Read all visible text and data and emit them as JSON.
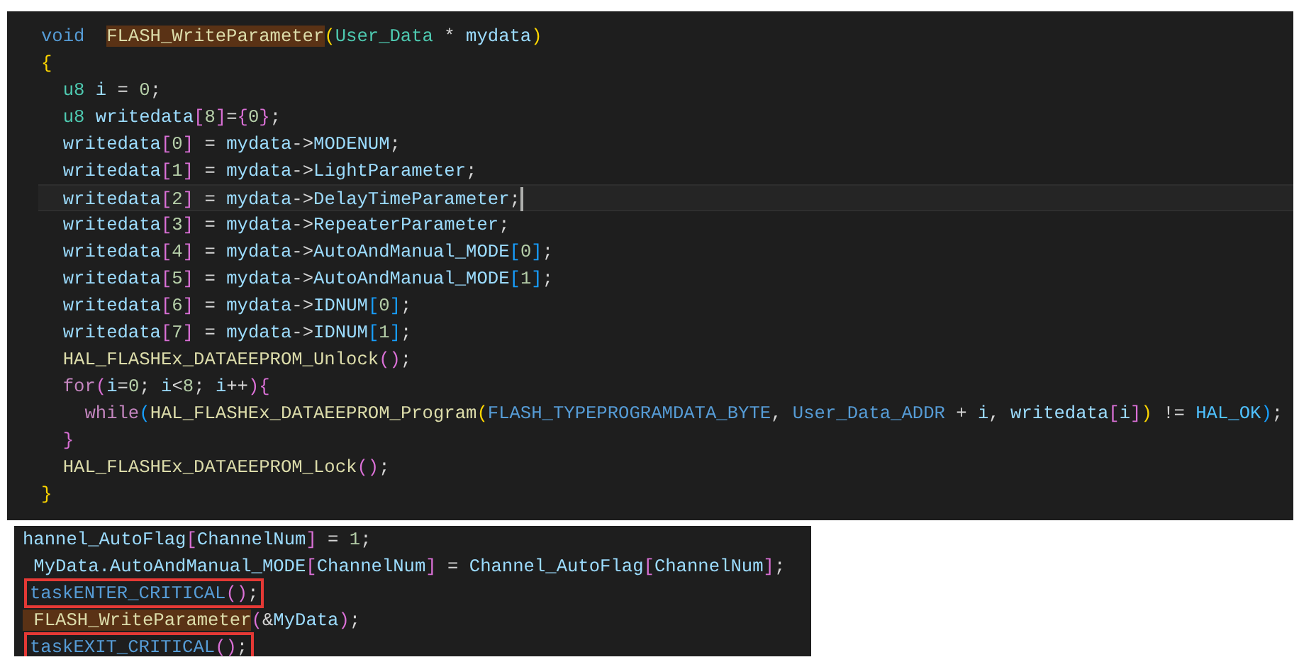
{
  "editors": [
    {
      "lines": [
        {
          "tokens": [
            {
              "kind": "kw",
              "text": "void  "
            },
            {
              "kind": "fnhl",
              "text": "FLASH_WriteParameter"
            },
            {
              "kind": "br1",
              "text": "("
            },
            {
              "kind": "type",
              "text": "User_Data"
            },
            {
              "kind": "plain",
              "text": " * "
            },
            {
              "kind": "var",
              "text": "mydata"
            },
            {
              "kind": "br1",
              "text": ")"
            }
          ]
        },
        {
          "tokens": [
            {
              "kind": "br1",
              "text": "{"
            }
          ]
        },
        {
          "tokens": [
            {
              "kind": "type",
              "text": "  u8"
            },
            {
              "kind": "var",
              "text": " i"
            },
            {
              "kind": "plain",
              "text": " = "
            },
            {
              "kind": "num",
              "text": "0"
            },
            {
              "kind": "plain",
              "text": ";"
            }
          ]
        },
        {
          "tokens": [
            {
              "kind": "type",
              "text": "  u8"
            },
            {
              "kind": "var",
              "text": " writedata"
            },
            {
              "kind": "br2",
              "text": "["
            },
            {
              "kind": "num",
              "text": "8"
            },
            {
              "kind": "br2",
              "text": "]"
            },
            {
              "kind": "plain",
              "text": "="
            },
            {
              "kind": "br2",
              "text": "{"
            },
            {
              "kind": "num",
              "text": "0"
            },
            {
              "kind": "br2",
              "text": "}"
            },
            {
              "kind": "plain",
              "text": ";"
            }
          ]
        },
        {
          "tokens": [
            {
              "kind": "var",
              "text": "  writedata"
            },
            {
              "kind": "br2",
              "text": "["
            },
            {
              "kind": "num",
              "text": "0"
            },
            {
              "kind": "br2",
              "text": "]"
            },
            {
              "kind": "plain",
              "text": " = "
            },
            {
              "kind": "var",
              "text": "mydata"
            },
            {
              "kind": "plain",
              "text": "->"
            },
            {
              "kind": "var",
              "text": "MODENUM"
            },
            {
              "kind": "plain",
              "text": ";"
            }
          ]
        },
        {
          "tokens": [
            {
              "kind": "var",
              "text": "  writedata"
            },
            {
              "kind": "br2",
              "text": "["
            },
            {
              "kind": "num",
              "text": "1"
            },
            {
              "kind": "br2",
              "text": "]"
            },
            {
              "kind": "plain",
              "text": " = "
            },
            {
              "kind": "var",
              "text": "mydata"
            },
            {
              "kind": "plain",
              "text": "->"
            },
            {
              "kind": "var",
              "text": "LightParameter"
            },
            {
              "kind": "plain",
              "text": ";"
            }
          ]
        },
        {
          "cursor": true,
          "tokens": [
            {
              "kind": "var",
              "text": "  writedata"
            },
            {
              "kind": "br2",
              "text": "["
            },
            {
              "kind": "num",
              "text": "2"
            },
            {
              "kind": "br2",
              "text": "]"
            },
            {
              "kind": "plain",
              "text": " = "
            },
            {
              "kind": "var",
              "text": "mydata"
            },
            {
              "kind": "plain",
              "text": "->"
            },
            {
              "kind": "var",
              "text": "DelayTimeParameter"
            },
            {
              "kind": "plain",
              "text": ";"
            }
          ]
        },
        {
          "tokens": [
            {
              "kind": "var",
              "text": "  writedata"
            },
            {
              "kind": "br2",
              "text": "["
            },
            {
              "kind": "num",
              "text": "3"
            },
            {
              "kind": "br2",
              "text": "]"
            },
            {
              "kind": "plain",
              "text": " = "
            },
            {
              "kind": "var",
              "text": "mydata"
            },
            {
              "kind": "plain",
              "text": "->"
            },
            {
              "kind": "var",
              "text": "RepeaterParameter"
            },
            {
              "kind": "plain",
              "text": ";"
            }
          ]
        },
        {
          "tokens": [
            {
              "kind": "var",
              "text": "  writedata"
            },
            {
              "kind": "br2",
              "text": "["
            },
            {
              "kind": "num",
              "text": "4"
            },
            {
              "kind": "br2",
              "text": "]"
            },
            {
              "kind": "plain",
              "text": " = "
            },
            {
              "kind": "var",
              "text": "mydata"
            },
            {
              "kind": "plain",
              "text": "->"
            },
            {
              "kind": "var",
              "text": "AutoAndManual_MODE"
            },
            {
              "kind": "br3",
              "text": "["
            },
            {
              "kind": "num",
              "text": "0"
            },
            {
              "kind": "br3",
              "text": "]"
            },
            {
              "kind": "plain",
              "text": ";"
            }
          ]
        },
        {
          "tokens": [
            {
              "kind": "var",
              "text": "  writedata"
            },
            {
              "kind": "br2",
              "text": "["
            },
            {
              "kind": "num",
              "text": "5"
            },
            {
              "kind": "br2",
              "text": "]"
            },
            {
              "kind": "plain",
              "text": " = "
            },
            {
              "kind": "var",
              "text": "mydata"
            },
            {
              "kind": "plain",
              "text": "->"
            },
            {
              "kind": "var",
              "text": "AutoAndManual_MODE"
            },
            {
              "kind": "br3",
              "text": "["
            },
            {
              "kind": "num",
              "text": "1"
            },
            {
              "kind": "br3",
              "text": "]"
            },
            {
              "kind": "plain",
              "text": ";"
            }
          ]
        },
        {
          "tokens": [
            {
              "kind": "var",
              "text": "  writedata"
            },
            {
              "kind": "br2",
              "text": "["
            },
            {
              "kind": "num",
              "text": "6"
            },
            {
              "kind": "br2",
              "text": "]"
            },
            {
              "kind": "plain",
              "text": " = "
            },
            {
              "kind": "var",
              "text": "mydata"
            },
            {
              "kind": "plain",
              "text": "->"
            },
            {
              "kind": "var",
              "text": "IDNUM"
            },
            {
              "kind": "br3",
              "text": "["
            },
            {
              "kind": "num",
              "text": "0"
            },
            {
              "kind": "br3",
              "text": "]"
            },
            {
              "kind": "plain",
              "text": ";"
            }
          ]
        },
        {
          "tokens": [
            {
              "kind": "var",
              "text": "  writedata"
            },
            {
              "kind": "br2",
              "text": "["
            },
            {
              "kind": "num",
              "text": "7"
            },
            {
              "kind": "br2",
              "text": "]"
            },
            {
              "kind": "plain",
              "text": " = "
            },
            {
              "kind": "var",
              "text": "mydata"
            },
            {
              "kind": "plain",
              "text": "->"
            },
            {
              "kind": "var",
              "text": "IDNUM"
            },
            {
              "kind": "br3",
              "text": "["
            },
            {
              "kind": "num",
              "text": "1"
            },
            {
              "kind": "br3",
              "text": "]"
            },
            {
              "kind": "plain",
              "text": ";"
            }
          ]
        },
        {
          "tokens": [
            {
              "kind": "fn",
              "text": "  HAL_FLASHEx_DATAEEPROM_Unlock"
            },
            {
              "kind": "br2",
              "text": "()"
            },
            {
              "kind": "plain",
              "text": ";"
            }
          ]
        },
        {
          "tokens": [
            {
              "kind": "ctl",
              "text": "  for"
            },
            {
              "kind": "br2",
              "text": "("
            },
            {
              "kind": "var",
              "text": "i"
            },
            {
              "kind": "plain",
              "text": "="
            },
            {
              "kind": "num",
              "text": "0"
            },
            {
              "kind": "plain",
              "text": "; "
            },
            {
              "kind": "var",
              "text": "i"
            },
            {
              "kind": "plain",
              "text": "<"
            },
            {
              "kind": "num",
              "text": "8"
            },
            {
              "kind": "plain",
              "text": "; "
            },
            {
              "kind": "var",
              "text": "i"
            },
            {
              "kind": "plain",
              "text": "++"
            },
            {
              "kind": "br2",
              "text": "){"
            }
          ]
        },
        {
          "tokens": [
            {
              "kind": "ctl",
              "text": "    while"
            },
            {
              "kind": "br3",
              "text": "("
            },
            {
              "kind": "fn",
              "text": "HAL_FLASHEx_DATAEEPROM_Program"
            },
            {
              "kind": "br1",
              "text": "("
            },
            {
              "kind": "macro",
              "text": "FLASH_TYPEPROGRAMDATA_BYTE"
            },
            {
              "kind": "plain",
              "text": ", "
            },
            {
              "kind": "macro",
              "text": "User_Data_ADDR"
            },
            {
              "kind": "plain",
              "text": " + "
            },
            {
              "kind": "var",
              "text": "i"
            },
            {
              "kind": "plain",
              "text": ", "
            },
            {
              "kind": "var",
              "text": "writedata"
            },
            {
              "kind": "br2",
              "text": "["
            },
            {
              "kind": "var",
              "text": "i"
            },
            {
              "kind": "br2",
              "text": "]"
            },
            {
              "kind": "br1",
              "text": ")"
            },
            {
              "kind": "plain",
              "text": " != "
            },
            {
              "kind": "macro2",
              "text": "HAL_OK"
            },
            {
              "kind": "br3",
              "text": ")"
            },
            {
              "kind": "plain",
              "text": ";"
            }
          ]
        },
        {
          "tokens": [
            {
              "kind": "br2",
              "text": "  }"
            }
          ]
        },
        {
          "tokens": [
            {
              "kind": "fn",
              "text": "  HAL_FLASHEx_DATAEEPROM_Lock"
            },
            {
              "kind": "br2",
              "text": "()"
            },
            {
              "kind": "plain",
              "text": ";"
            }
          ]
        },
        {
          "tokens": [
            {
              "kind": "br1",
              "text": "}"
            }
          ]
        }
      ]
    },
    {
      "lines": [
        {
          "tokens": [
            {
              "kind": "var",
              "text": "hannel_AutoFlag"
            },
            {
              "kind": "br2",
              "text": "["
            },
            {
              "kind": "var",
              "text": "ChannelNum"
            },
            {
              "kind": "br2",
              "text": "]"
            },
            {
              "kind": "plain",
              "text": " = "
            },
            {
              "kind": "num",
              "text": "1"
            },
            {
              "kind": "plain",
              "text": ";"
            }
          ]
        },
        {
          "tokens": [
            {
              "kind": "var",
              "text": " MyData.AutoAndManual_MODE"
            },
            {
              "kind": "br2",
              "text": "["
            },
            {
              "kind": "var",
              "text": "ChannelNum"
            },
            {
              "kind": "br2",
              "text": "]"
            },
            {
              "kind": "plain",
              "text": " = "
            },
            {
              "kind": "var",
              "text": "Channel_AutoFlag"
            },
            {
              "kind": "br2",
              "text": "["
            },
            {
              "kind": "var",
              "text": "ChannelNum"
            },
            {
              "kind": "br2",
              "text": "]"
            },
            {
              "kind": "plain",
              "text": ";"
            }
          ]
        },
        {
          "highlighted": true,
          "tokens": [
            {
              "kind": "macro",
              "text": "taskENTER_CRITICAL"
            },
            {
              "kind": "br2",
              "text": "()"
            },
            {
              "kind": "plain",
              "text": ";"
            }
          ]
        },
        {
          "tokens": [
            {
              "kind": "fnhl",
              "text": " FLASH_WriteParameter"
            },
            {
              "kind": "br2",
              "text": "("
            },
            {
              "kind": "plain",
              "text": "&"
            },
            {
              "kind": "var",
              "text": "MyData"
            },
            {
              "kind": "br2",
              "text": ")"
            },
            {
              "kind": "plain",
              "text": ";"
            }
          ]
        },
        {
          "highlighted": true,
          "tokens": [
            {
              "kind": "macro",
              "text": "taskEXIT_CRITICAL"
            },
            {
              "kind": "br2",
              "text": "()"
            },
            {
              "kind": "plain",
              "text": ";"
            }
          ]
        }
      ]
    }
  ]
}
